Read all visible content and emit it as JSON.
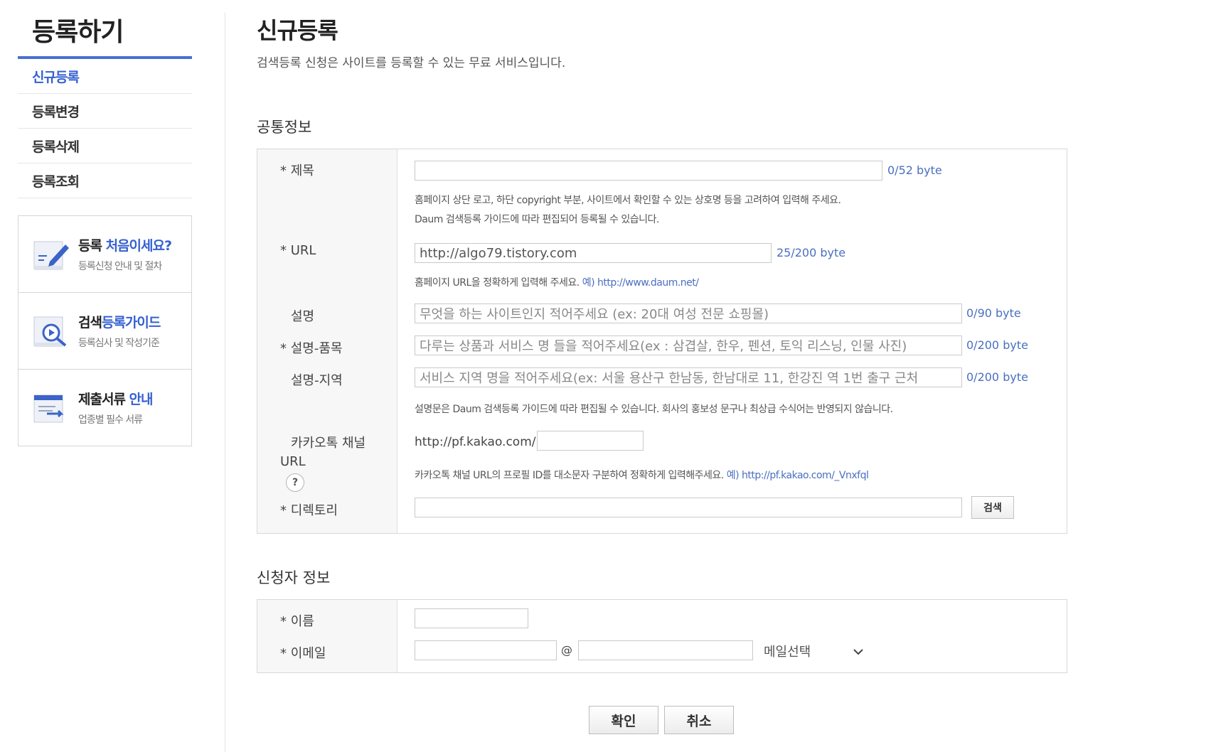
{
  "sidebar": {
    "title": "등록하기",
    "menu": [
      "신규등록",
      "등록변경",
      "등록삭제",
      "등록조회"
    ],
    "banners": [
      {
        "title_a": "등록 ",
        "title_hl": "처음이세요?",
        "sub": "등록신청 안내 및 절차",
        "icon": "pencil-icon"
      },
      {
        "title_a": "검색",
        "title_hl": "등록가이드",
        "sub": "등록심사 및 작성기준",
        "icon": "magnifier-icon"
      },
      {
        "title_a": "제출서류 ",
        "title_hl": "안내",
        "sub": "업종별 필수 서류",
        "icon": "document-icon"
      }
    ]
  },
  "main": {
    "title": "신규등록",
    "desc": "검색등록 신청은 사이트를 등록할 수 있는 무료 서비스입니다.",
    "common": {
      "section_title": "공통정보",
      "title_label": "* 제목",
      "title_value": "",
      "title_count": "0/52 byte",
      "title_hint1": "홈페이지 상단 로고, 하단 copyright 부분, 사이트에서 확인할 수 있는 상호명 등을 고려하여 입력해 주세요.",
      "title_hint2": "Daum 검색등록 가이드에 따라 편집되어 등록될 수 있습니다.",
      "url_label": "* URL",
      "url_value": "http://algo79.tistory.com",
      "url_count": "25/200 byte",
      "url_hint": "홈페이지 URL을 정확하게 입력해 주세요. ",
      "url_hint_link": "예) http://www.daum.net/",
      "desc_label": "설명",
      "desc_placeholder": "무엇을 하는 사이트인지 적어주세요 (ex: 20대 여성 전문 쇼핑몰)",
      "desc_count": "0/90 byte",
      "item_label": "* 설명-품목",
      "item_placeholder": "다루는 상품과 서비스 명 들을 적어주세요(ex : 삼겹살, 한우, 펜션, 토익 리스닝, 인물 사진)",
      "item_count": "0/200 byte",
      "region_label": "설명-지역",
      "region_placeholder": "서비스 지역 명을 적어주세요(ex: 서울  용산구 한남동, 한남대로 11, 한강진 역 1번 출구 근처",
      "region_count": "0/200 byte",
      "desc_hint": "설명문은 Daum 검색등록 가이드에 따라 편집될 수 있습니다. 회사의 홍보성 문구나 최상급 수식어는 반영되지 않습니다.",
      "kakao_label1": "카카오톡 채널",
      "kakao_label2": "URL",
      "kakao_prefix": "http://pf.kakao.com/",
      "kakao_value": "",
      "kakao_hint": "카카오톡 채널 URL의 프로필 ID를 대소문자 구분하여 정확하게 입력해주세요. ",
      "kakao_hint_link": "예) http://pf.kakao.com/_Vnxfql",
      "dir_label": "* 디렉토리",
      "dir_value": "",
      "search_btn": "검색"
    },
    "applicant": {
      "section_title": "신청자 정보",
      "name_label": "* 이름",
      "name_value": "",
      "email_label": "* 이메일",
      "email_at": "@",
      "email_select": "메일선택"
    },
    "confirm_btn": "확인",
    "cancel_btn": "취소"
  }
}
